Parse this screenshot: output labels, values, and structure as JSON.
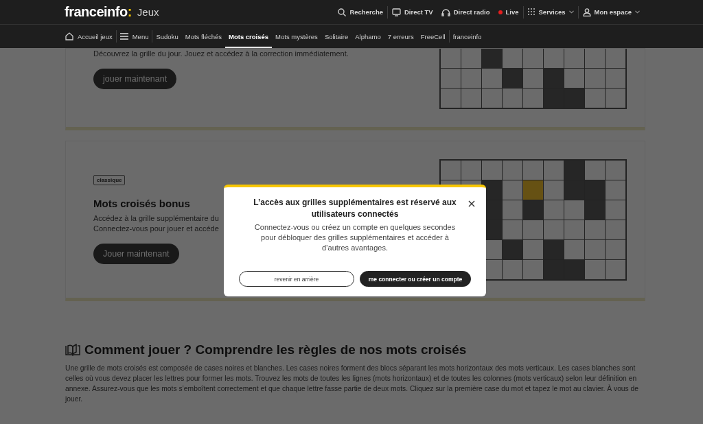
{
  "header": {
    "logo": "franceinfo",
    "logo_mark": ":",
    "section": "Jeux",
    "links": [
      {
        "label": "Recherche",
        "kind": "search",
        "dropdown": false
      },
      {
        "label": "Direct TV",
        "kind": "tv",
        "dropdown": false
      },
      {
        "label": "Direct radio",
        "kind": "radio",
        "dropdown": false
      },
      {
        "label": "Live",
        "kind": "live",
        "dropdown": false
      },
      {
        "label": "Services",
        "kind": "services",
        "dropdown": true
      },
      {
        "label": "Mon espace",
        "kind": "account",
        "dropdown": true
      }
    ]
  },
  "nav": {
    "items": [
      {
        "label": "Accueil jeux",
        "kind": "home",
        "selected": false
      },
      {
        "label": "Menu",
        "kind": "menu",
        "selected": false
      },
      {
        "label": "Sudoku",
        "kind": "game",
        "selected": false
      },
      {
        "label": "Mots fléchés",
        "kind": "game",
        "selected": false
      },
      {
        "label": "Mots croisés",
        "kind": "game",
        "selected": true
      },
      {
        "label": "Mots mystères",
        "kind": "game",
        "selected": false
      },
      {
        "label": "Solitaire",
        "kind": "game",
        "selected": false
      },
      {
        "label": "Alphamo",
        "kind": "game",
        "selected": false
      },
      {
        "label": "7 erreurs",
        "kind": "game",
        "selected": false
      },
      {
        "label": "FreeCell",
        "kind": "game",
        "selected": false
      },
      {
        "label": "franceinfo",
        "kind": "site",
        "selected": false
      }
    ]
  },
  "cards": [
    {
      "description": [
        "Découvrez la grille du jour. Jouez et accédez à la correction immédiatement."
      ],
      "button": "jouer maintenant",
      "grid": [
        [
          {
            "dark": false,
            "selected": false
          },
          {
            "dark": false,
            "selected": false
          },
          {
            "dark": true,
            "selected": false
          },
          {
            "dark": false,
            "selected": false
          },
          {
            "dark": false,
            "selected": false
          },
          {
            "dark": false,
            "selected": false
          },
          {
            "dark": false,
            "selected": false
          },
          {
            "dark": false,
            "selected": false
          },
          {
            "dark": false,
            "selected": false
          }
        ],
        [
          {
            "dark": false,
            "selected": false
          },
          {
            "dark": false,
            "selected": false
          },
          {
            "dark": false,
            "selected": false
          },
          {
            "dark": true,
            "selected": false
          },
          {
            "dark": false,
            "selected": false
          },
          {
            "dark": true,
            "selected": false
          },
          {
            "dark": false,
            "selected": false
          },
          {
            "dark": false,
            "selected": false
          },
          {
            "dark": false,
            "selected": false
          }
        ],
        [
          {
            "dark": false,
            "selected": false
          },
          {
            "dark": false,
            "selected": false
          },
          {
            "dark": false,
            "selected": false
          },
          {
            "dark": false,
            "selected": false
          },
          {
            "dark": false,
            "selected": false
          },
          {
            "dark": true,
            "selected": false
          },
          {
            "dark": true,
            "selected": false
          },
          {
            "dark": false,
            "selected": false
          },
          {
            "dark": false,
            "selected": false
          }
        ]
      ]
    },
    {
      "badge": "classique",
      "title": "Mots croisés bonus",
      "description": [
        "Accédez à la grille supplémentaire du",
        "Connectez-vous pour jouer et accéde"
      ],
      "button": "Jouer maintenant",
      "grid": [
        [
          {
            "dark": false,
            "selected": false
          },
          {
            "dark": false,
            "selected": false
          },
          {
            "dark": false,
            "selected": false
          },
          {
            "dark": false,
            "selected": false
          },
          {
            "dark": false,
            "selected": false
          },
          {
            "dark": false,
            "selected": false
          },
          {
            "dark": true,
            "selected": false
          },
          {
            "dark": false,
            "selected": false
          },
          {
            "dark": false,
            "selected": false
          }
        ],
        [
          {
            "dark": false,
            "selected": false
          },
          {
            "dark": false,
            "selected": false
          },
          {
            "dark": true,
            "selected": false
          },
          {
            "dark": false,
            "selected": false
          },
          {
            "dark": false,
            "selected": true
          },
          {
            "dark": false,
            "selected": false
          },
          {
            "dark": true,
            "selected": false
          },
          {
            "dark": true,
            "selected": false
          },
          {
            "dark": false,
            "selected": false
          }
        ],
        [
          {
            "dark": true,
            "selected": false
          },
          {
            "dark": false,
            "selected": false
          },
          {
            "dark": true,
            "selected": false
          },
          {
            "dark": false,
            "selected": false
          },
          {
            "dark": false,
            "selected": false
          },
          {
            "dark": true,
            "selected": false
          },
          {
            "dark": false,
            "selected": false
          }
        ],
        [
          {
            "dark": true,
            "selected": false
          },
          {
            "dark": false,
            "selected": false
          },
          {
            "dark": false,
            "selected": false
          },
          {
            "dark": false,
            "selected": false
          },
          {
            "dark": false,
            "selected": false
          },
          {
            "dark": false,
            "selected": false
          },
          {
            "dark": false,
            "selected": false
          }
        ],
        [
          {
            "dark": false,
            "selected": false
          },
          {
            "dark": true,
            "selected": false
          },
          {
            "dark": false,
            "selected": false
          },
          {
            "dark": true,
            "selected": false
          },
          {
            "dark": false,
            "selected": false
          },
          {
            "dark": false,
            "selected": false
          },
          {
            "dark": false,
            "selected": false
          }
        ],
        [
          {
            "dark": false,
            "selected": false
          },
          {
            "dark": false,
            "selected": false
          },
          {
            "dark": false,
            "selected": false
          },
          {
            "dark": true,
            "selected": false
          },
          {
            "dark": true,
            "selected": false
          },
          {
            "dark": false,
            "selected": false
          },
          {
            "dark": false,
            "selected": false
          }
        ]
      ]
    }
  ],
  "rules": {
    "title": "Comment jouer ? Comprendre les règles de nos mots croisés",
    "text": "Une grille de mots croisés est composée de cases noires et blanches. Les cases noires forment des blocs séparant les mots horizontaux des mots verticaux. Les cases blanches sont celles où vous devez placer les lettres pour former les mots. Trouvez les mots de toutes les lignes (mots horizontaux) et de toutes les colonnes (mots verticaux) selon leur définition en annexe. Assurez-vous que les mots s’emboîtent correctement et que chaque lettre fasse partie de deux mots. Cliquez sur la première case du mot et tapez le mot au clavier. À vous de jouer."
  },
  "modal": {
    "title": "L’accès aux grilles supplémentaires est réservé aux utilisateurs connectés",
    "text": "Connectez-vous ou créez un compte en quelques secondes pour débloquer des grilles supplémentaires et accéder à d’autres avantages.",
    "buttons": [
      {
        "label": "revenir en arrière",
        "kind": "secondary"
      },
      {
        "label": "me connecter ou créer un compte",
        "kind": "primary"
      }
    ]
  }
}
